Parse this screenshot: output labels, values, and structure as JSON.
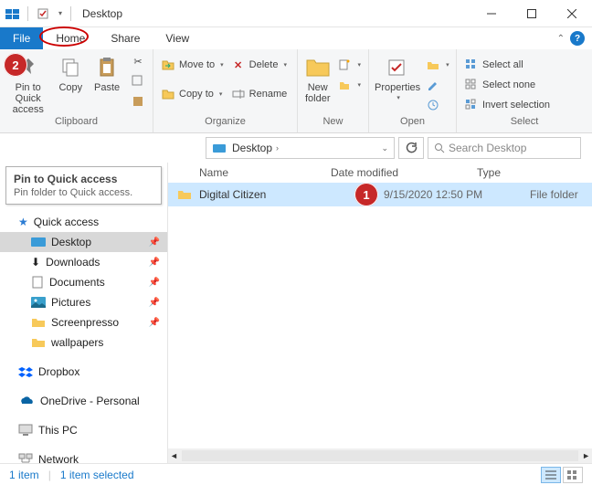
{
  "title": "Desktop",
  "tabs": {
    "file": "File",
    "home": "Home",
    "share": "Share",
    "view": "View"
  },
  "ribbon": {
    "pin_quick_access": "Pin to Quick\naccess",
    "copy": "Copy",
    "paste": "Paste",
    "clipboard_group": "Clipboard",
    "move_to": "Move to",
    "copy_to": "Copy to",
    "delete": "Delete",
    "rename": "Rename",
    "organize_group": "Organize",
    "new_folder": "New\nfolder",
    "new_group": "New",
    "properties": "Properties",
    "open_group": "Open",
    "select_all": "Select all",
    "select_none": "Select none",
    "invert_selection": "Invert selection",
    "select_group": "Select"
  },
  "tooltip": {
    "title": "Pin to Quick access",
    "sub": "Pin folder to Quick access."
  },
  "breadcrumb": "Desktop",
  "search_placeholder": "Search Desktop",
  "nav": {
    "quick_access": "Quick access",
    "desktop": "Desktop",
    "downloads": "Downloads",
    "documents": "Documents",
    "pictures": "Pictures",
    "screenpresso": "Screenpresso",
    "wallpapers": "wallpapers",
    "dropbox": "Dropbox",
    "onedrive": "OneDrive - Personal",
    "this_pc": "This PC",
    "network": "Network"
  },
  "columns": {
    "name": "Name",
    "date": "Date modified",
    "type": "Type"
  },
  "rows": [
    {
      "name": "Digital Citizen",
      "date": "9/15/2020 12:50 PM",
      "type": "File folder"
    }
  ],
  "status": {
    "count": "1 item",
    "selected": "1 item selected"
  },
  "annotations": {
    "one": "1",
    "two": "2"
  }
}
